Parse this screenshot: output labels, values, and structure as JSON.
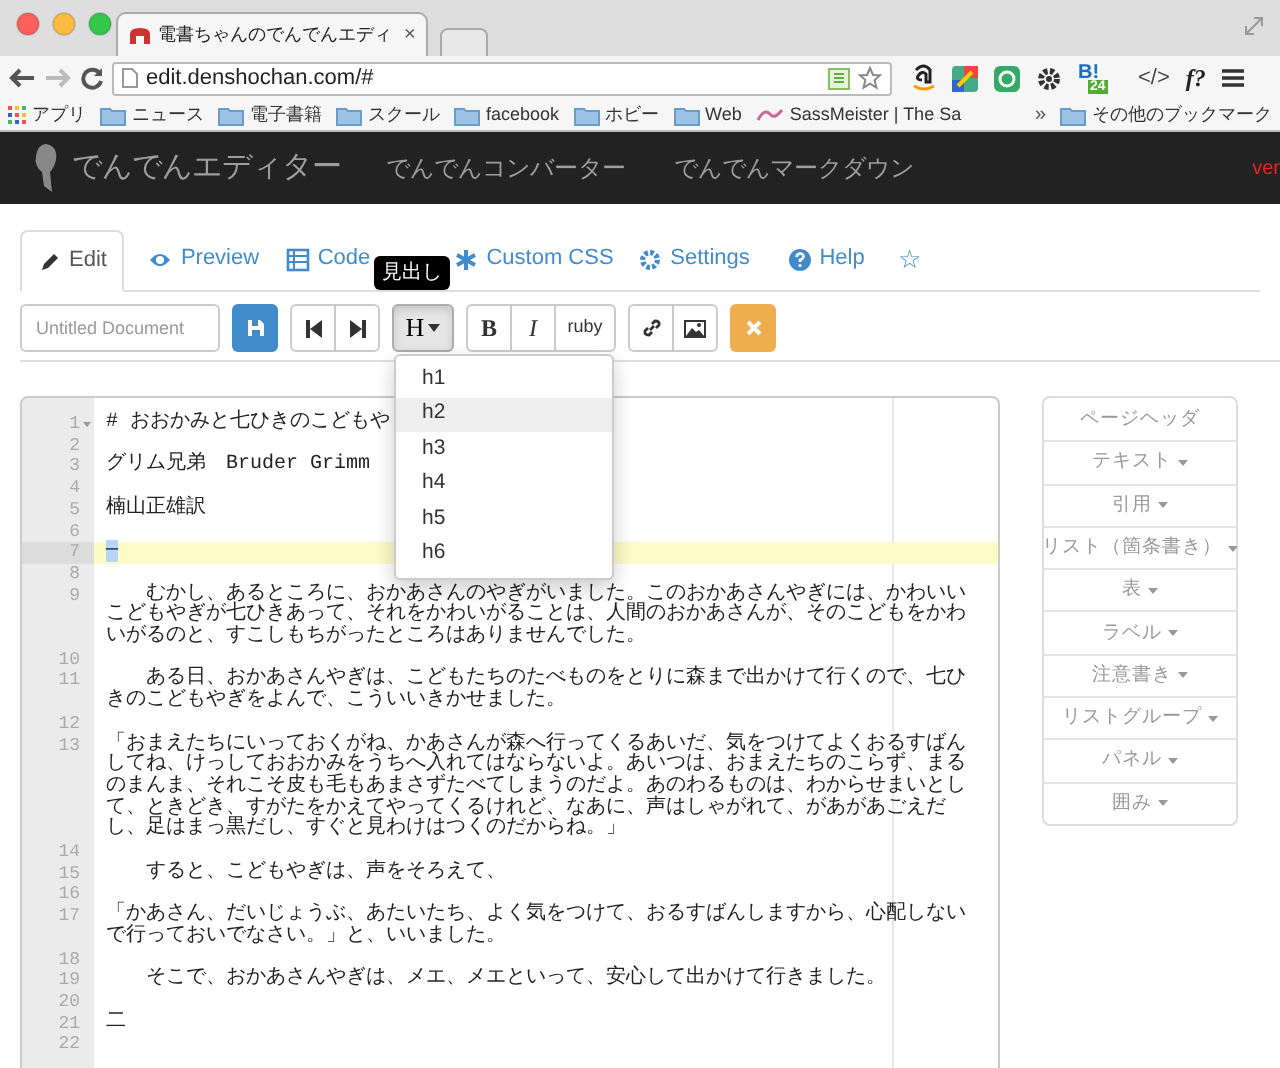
{
  "browser": {
    "tab_title": "電書ちゃんのでんでんエディ",
    "tab_close": "×",
    "url": "edit.denshochan.com/#",
    "hatena_label": "B!",
    "hatena_count": "24",
    "code_label": "</>",
    "formula_label": "f?"
  },
  "bookmarks": [
    {
      "label": "アプリ",
      "kind": "apps"
    },
    {
      "label": "ニュース",
      "kind": "folder"
    },
    {
      "label": "電子書籍",
      "kind": "folder"
    },
    {
      "label": "スクール",
      "kind": "folder"
    },
    {
      "label": "facebook",
      "kind": "folder"
    },
    {
      "label": "ホビー",
      "kind": "folder"
    },
    {
      "label": "Web",
      "kind": "folder"
    },
    {
      "label": "SassMeister | The Sa",
      "kind": "site"
    }
  ],
  "bookmarks_more": "»",
  "other_bookmarks": "その他のブックマーク",
  "navbar": {
    "brand": "でんでんエディター",
    "links": [
      "でんでんコンバーター",
      "でんでんマークダウン"
    ],
    "version": "ver"
  },
  "tabs": [
    {
      "label": "Edit",
      "selected": true
    },
    {
      "label": "Preview",
      "selected": false
    },
    {
      "label": "Code",
      "selected": false
    },
    {
      "label": "Custom CSS",
      "selected": false
    },
    {
      "label": "Settings",
      "selected": false
    },
    {
      "label": "Help",
      "selected": false
    },
    {
      "label": "☆",
      "selected": false
    }
  ],
  "toolbar": {
    "title_placeholder": "Untitled Document",
    "heading_label": "H",
    "heading_pressed": true,
    "bold": "B",
    "italic": "I",
    "ruby": "ruby",
    "tooltip": "見出し"
  },
  "heading_menu": [
    {
      "label": "h1",
      "selected": false
    },
    {
      "label": "h2",
      "selected": true
    },
    {
      "label": "h3",
      "selected": false
    },
    {
      "label": "h4",
      "selected": false
    },
    {
      "label": "h5",
      "selected": false
    },
    {
      "label": "h6",
      "selected": false
    }
  ],
  "editor": {
    "lines": [
      {
        "number": "1",
        "text": "# おおかみと七ひきのこどもや",
        "active": false,
        "fold": true
      },
      {
        "number": "2",
        "active": false,
        "fold": false
      },
      {
        "number": "3",
        "text": "グリム兄弟　Bruder Grimm",
        "active": false,
        "fold": false
      },
      {
        "number": "4",
        "active": false,
        "fold": false
      },
      {
        "number": "5",
        "text": "楠山正雄訳",
        "active": false,
        "fold": false
      },
      {
        "number": "6",
        "active": false,
        "fold": false
      },
      {
        "number": "7",
        "text": "—",
        "active": true,
        "fold": false
      },
      {
        "number": "8",
        "active": false,
        "fold": false
      },
      {
        "number": "9",
        "text": "　　むかし、あるところに、おかあさんのやぎがいました。このおかあさんやぎには、かわいいこどもやぎが七ひきあって、それをかわいがることは、人間のおかあさんが、そのこどもをかわいがるのと、すこしもちがったところはありませんでした。",
        "active": false,
        "fold": false
      },
      {
        "number": "10",
        "active": false,
        "fold": false
      },
      {
        "number": "11",
        "text": "　　ある日、おかあさんやぎは、こどもたちのたべものをとりに森まで出かけて行くので、七ひきのこどもやぎをよんで、こういいきかせました。",
        "active": false,
        "fold": false
      },
      {
        "number": "12",
        "active": false,
        "fold": false
      },
      {
        "number": "13",
        "text": "「おまえたちにいっておくがね、かあさんが森へ行ってくるあいだ、気をつけてよくおるすばんしてね、けっしておおかみをうちへ入れてはならないよ。あいつは、おまえたちのこらず、まるのまんま、それこそ皮も毛もあまさずたべてしまうのだよ。あのわるものは、わからせまいとして、ときどき、すがたをかえてやってくるけれど、なあに、声はしゃがれて、があがあごえだし、足はまっ黒だし、すぐと見わけはつくのだからね。」",
        "active": false,
        "fold": false
      },
      {
        "number": "14",
        "active": false,
        "fold": false
      },
      {
        "number": "15",
        "text": "　　すると、こどもやぎは、声をそろえて、",
        "active": false,
        "fold": false
      },
      {
        "number": "16",
        "active": false,
        "fold": false
      },
      {
        "number": "17",
        "text": "「かあさん、だいじょうぶ、あたいたち、よく気をつけて、おるすばんしますから、心配しないで行っておいでなさい。」と、いいました。",
        "active": false,
        "fold": false
      },
      {
        "number": "18",
        "active": false,
        "fold": false
      },
      {
        "number": "19",
        "text": "　　そこで、おかあさんやぎは、メエ、メエといって、安心して出かけて行きました。",
        "active": false,
        "fold": false
      },
      {
        "number": "20",
        "active": false,
        "fold": false
      },
      {
        "number": "21",
        "text": "二",
        "active": false,
        "fold": false
      },
      {
        "number": "22",
        "active": false,
        "fold": false
      }
    ]
  },
  "side_buttons": [
    {
      "label": "ページヘッダ",
      "caret": false
    },
    {
      "label": "テキスト",
      "caret": true
    },
    {
      "label": "引用",
      "caret": true
    },
    {
      "label": "リスト（箇条書き）",
      "caret": true
    },
    {
      "label": "表",
      "caret": true
    },
    {
      "label": "ラベル",
      "caret": true
    },
    {
      "label": "注意書き",
      "caret": true
    },
    {
      "label": "リストグループ",
      "caret": true
    },
    {
      "label": "パネル",
      "caret": true
    },
    {
      "label": "囲み",
      "caret": true
    }
  ]
}
